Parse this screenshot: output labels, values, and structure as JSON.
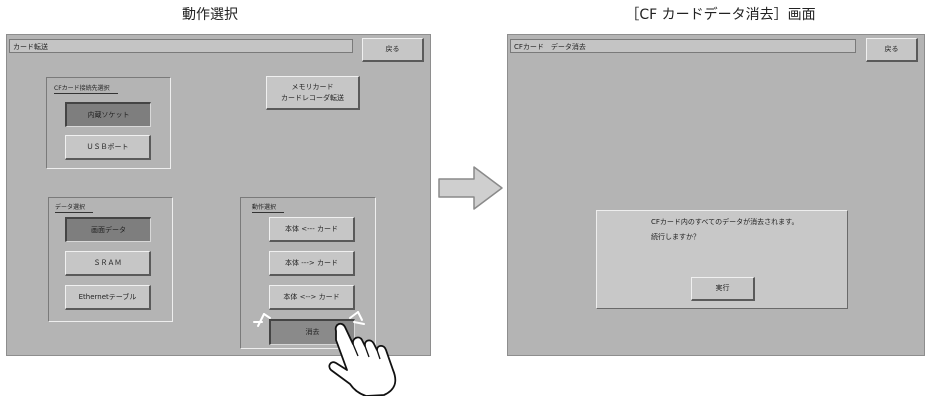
{
  "captions": {
    "left": "動作選択",
    "right": "［CF カードデータ消去］画面"
  },
  "left_screen": {
    "title": "カード転送",
    "back_button": "戻る",
    "memory_button": [
      "メモリカード",
      "カードレコーダ転送"
    ],
    "cf_group": {
      "label": "CFカード接続先選択",
      "buttons": [
        "内蔵ソケット",
        "ＵＳＢポート"
      ]
    },
    "data_group": {
      "label": "データ選択",
      "buttons": [
        "画面データ",
        "ＳＲＡＭ",
        "Ethernetテーブル"
      ]
    },
    "action_group": {
      "label": "動作選択",
      "buttons": [
        "本体 <--- カード",
        "本体 ---> カード",
        "本体 <--> カード",
        "消去"
      ]
    }
  },
  "right_screen": {
    "title": "CFカード　データ消去",
    "back_button": "戻る",
    "dialog": {
      "line1": "CFカード内のすべてのデータが消去されます。",
      "line2": "続行しますか？",
      "execute_button": "実行"
    }
  },
  "colors": {
    "screen_bg": "#b4b4b4",
    "button_face": "#c6c6c6",
    "selected_button": "#7e7e7e"
  },
  "icons": [
    "right-arrow-icon",
    "pointing-hand-icon"
  ]
}
